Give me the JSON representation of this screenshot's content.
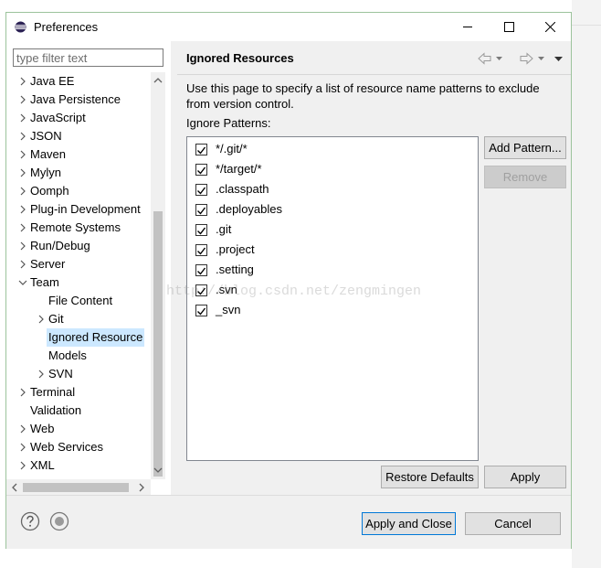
{
  "window": {
    "title": "Preferences"
  },
  "filter": {
    "placeholder": "type filter text"
  },
  "tree": [
    {
      "label": "Java EE",
      "level": 0,
      "state": "collapsed"
    },
    {
      "label": "Java Persistence",
      "level": 0,
      "state": "collapsed"
    },
    {
      "label": "JavaScript",
      "level": 0,
      "state": "collapsed"
    },
    {
      "label": "JSON",
      "level": 0,
      "state": "collapsed"
    },
    {
      "label": "Maven",
      "level": 0,
      "state": "collapsed"
    },
    {
      "label": "Mylyn",
      "level": 0,
      "state": "collapsed"
    },
    {
      "label": "Oomph",
      "level": 0,
      "state": "collapsed"
    },
    {
      "label": "Plug-in Development",
      "level": 0,
      "state": "collapsed"
    },
    {
      "label": "Remote Systems",
      "level": 0,
      "state": "collapsed"
    },
    {
      "label": "Run/Debug",
      "level": 0,
      "state": "collapsed"
    },
    {
      "label": "Server",
      "level": 0,
      "state": "collapsed"
    },
    {
      "label": "Team",
      "level": 0,
      "state": "expanded"
    },
    {
      "label": "File Content",
      "level": 1,
      "state": "leaf"
    },
    {
      "label": "Git",
      "level": 1,
      "state": "collapsed"
    },
    {
      "label": "Ignored Resource",
      "level": 1,
      "state": "leaf",
      "selected": true
    },
    {
      "label": "Models",
      "level": 1,
      "state": "leaf"
    },
    {
      "label": "SVN",
      "level": 1,
      "state": "collapsed"
    },
    {
      "label": "Terminal",
      "level": 0,
      "state": "collapsed"
    },
    {
      "label": "Validation",
      "level": 0,
      "state": "leaf"
    },
    {
      "label": "Web",
      "level": 0,
      "state": "collapsed"
    },
    {
      "label": "Web Services",
      "level": 0,
      "state": "collapsed"
    },
    {
      "label": "XML",
      "level": 0,
      "state": "collapsed"
    }
  ],
  "page": {
    "title": "Ignored Resources",
    "description": "Use this page to specify a list of resource name patterns to exclude from version control.",
    "patterns_label": "Ignore Patterns:",
    "patterns": [
      {
        "text": "*/.git/*",
        "checked": true
      },
      {
        "text": "*/target/*",
        "checked": true
      },
      {
        "text": ".classpath",
        "checked": true
      },
      {
        "text": ".deployables",
        "checked": true
      },
      {
        "text": ".git",
        "checked": true
      },
      {
        "text": ".project",
        "checked": true
      },
      {
        "text": ".setting",
        "checked": true
      },
      {
        "text": ".svn",
        "checked": true
      },
      {
        "text": "_svn",
        "checked": true
      }
    ],
    "add_pattern": "Add Pattern...",
    "remove": "Remove",
    "restore_defaults": "Restore Defaults",
    "apply": "Apply"
  },
  "footer": {
    "apply_and_close": "Apply and Close",
    "cancel": "Cancel"
  },
  "watermark": "http://blog.csdn.net/zengmingen"
}
